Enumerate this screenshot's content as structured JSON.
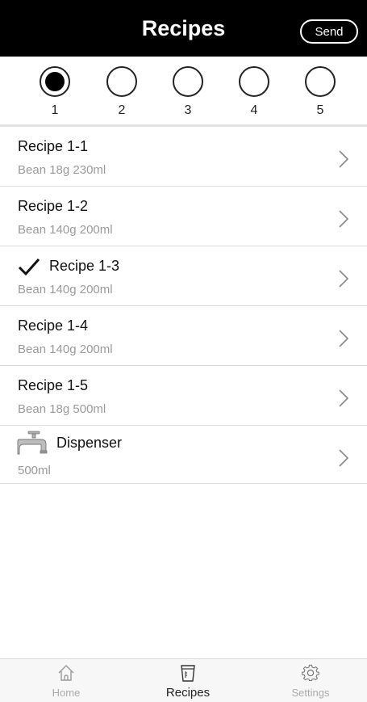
{
  "header": {
    "title": "Recipes",
    "send_label": "Send"
  },
  "selector": {
    "selected": "1",
    "options": [
      {
        "label": "1",
        "selected": true
      },
      {
        "label": "2",
        "selected": false
      },
      {
        "label": "3",
        "selected": false
      },
      {
        "label": "4",
        "selected": false
      },
      {
        "label": "5",
        "selected": false
      }
    ]
  },
  "recipes": [
    {
      "name": "Recipe 1-1",
      "detail": "Bean 18g 230ml",
      "checked": false
    },
    {
      "name": "Recipe 1-2",
      "detail": "Bean 140g 200ml",
      "checked": false
    },
    {
      "name": "Recipe 1-3",
      "detail": "Bean 140g 200ml",
      "checked": true
    },
    {
      "name": "Recipe 1-4",
      "detail": "Bean 140g 200ml",
      "checked": false
    },
    {
      "name": "Recipe 1-5",
      "detail": "Bean 18g 500ml",
      "checked": false
    }
  ],
  "dispenser": {
    "name": "Dispenser",
    "detail": "500ml",
    "icon": "faucet-icon"
  },
  "tabs": [
    {
      "label": "Home",
      "icon": "home-icon",
      "active": false
    },
    {
      "label": "Recipes",
      "icon": "cup-icon",
      "active": true
    },
    {
      "label": "Settings",
      "icon": "gear-icon",
      "active": false
    }
  ]
}
